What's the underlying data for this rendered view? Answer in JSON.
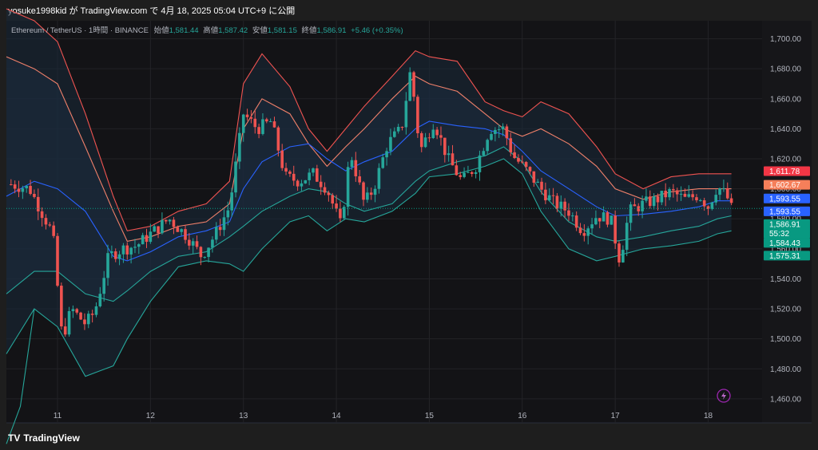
{
  "caption": "yosuke1998kid が TradingView.com で 4月 18, 2025 05:04 UTC+9 に公開",
  "legend": {
    "symbol": "Ethereum / TetherUS · 1時間 · BINANCE",
    "open_label": "始値",
    "open": "1,581.44",
    "high_label": "高値",
    "high": "1,587.42",
    "low_label": "安値",
    "low": "1,581.15",
    "close_label": "終値",
    "close": "1,586.91",
    "change": "+5.46 (+0.35%)"
  },
  "footer": {
    "logo": "TV",
    "wordmark": "TradingView"
  },
  "colors": {
    "up": "#26a69a",
    "down": "#ef5350",
    "basis": "#2962ff",
    "outer_upper": "#ef5350",
    "inner_upper": "#f0806a",
    "inner_lower": "#26a69a",
    "outer_lower": "#26a69a"
  },
  "icons": {
    "bolt": "lightning-icon"
  },
  "chart_data": {
    "type": "candlestick",
    "title": "Ethereum / TetherUS · 1時間 · BINANCE",
    "xlabel": "",
    "ylabel": "",
    "x_ticks": [
      "11",
      "12",
      "13",
      "14",
      "15",
      "16",
      "17",
      "18"
    ],
    "y_ticks": [
      "1,460.00",
      "1,480.00",
      "1,500.00",
      "1,520.00",
      "1,540.00",
      "1,560.00",
      "1,580.00",
      "1,600.00",
      "1,620.00",
      "1,640.00",
      "1,660.00",
      "1,680.00",
      "1,700.00"
    ],
    "y_tick_values": [
      1460,
      1480,
      1500,
      1520,
      1540,
      1560,
      1580,
      1600,
      1620,
      1640,
      1660,
      1680,
      1700
    ],
    "ylim": [
      1444,
      1712
    ],
    "x_range": [
      10.45,
      18.58
    ],
    "grid": true,
    "price_labels": [
      {
        "text": "1,611.78",
        "value": 1611.78,
        "color": "#f23645",
        "sub": ""
      },
      {
        "text": "1,602.67",
        "value": 1602.67,
        "color": "#f57f5a",
        "sub": ""
      },
      {
        "text": "1,593.55",
        "value": 1593.55,
        "color": "#2962ff",
        "sub": ""
      },
      {
        "text": "1,593.55",
        "value": 1585.0,
        "color": "#2962ff",
        "sub": ""
      },
      {
        "text": "1,586.91",
        "value": 1576.5,
        "color": "#089981",
        "sub": "55:32"
      },
      {
        "text": "1,584.43",
        "value": 1564.0,
        "color": "#089981",
        "sub": ""
      },
      {
        "text": "1,575.31",
        "value": 1555.5,
        "color": "#089981",
        "sub": ""
      }
    ],
    "last_price": 1586.91,
    "bands": {
      "x": [
        10.45,
        10.75,
        11.0,
        11.3,
        11.6,
        11.75,
        12.0,
        12.3,
        12.6,
        12.85,
        13.0,
        13.2,
        13.5,
        13.7,
        13.9,
        14.1,
        14.3,
        14.6,
        14.85,
        15.0,
        15.3,
        15.6,
        15.8,
        16.0,
        16.2,
        16.5,
        16.8,
        17.0,
        17.3,
        17.6,
        17.9,
        18.1,
        18.25
      ],
      "outer_upper": [
        1720,
        1712,
        1698,
        1650,
        1595,
        1572,
        1575,
        1585,
        1590,
        1605,
        1670,
        1690,
        1668,
        1640,
        1625,
        1640,
        1655,
        1675,
        1692,
        1688,
        1685,
        1658,
        1652,
        1648,
        1658,
        1650,
        1628,
        1610,
        1600,
        1608,
        1610,
        1610,
        1610
      ],
      "inner_upper": [
        1688,
        1680,
        1670,
        1628,
        1585,
        1565,
        1568,
        1575,
        1578,
        1590,
        1640,
        1660,
        1650,
        1630,
        1615,
        1628,
        1640,
        1660,
        1675,
        1670,
        1665,
        1650,
        1640,
        1635,
        1640,
        1630,
        1615,
        1600,
        1593,
        1598,
        1600,
        1600,
        1600
      ],
      "basis": [
        1595,
        1605,
        1600,
        1585,
        1555,
        1552,
        1558,
        1568,
        1572,
        1578,
        1600,
        1618,
        1628,
        1630,
        1620,
        1612,
        1618,
        1625,
        1640,
        1645,
        1642,
        1640,
        1636,
        1625,
        1612,
        1600,
        1588,
        1582,
        1583,
        1585,
        1588,
        1592,
        1592
      ],
      "inner_lower": [
        1530,
        1545,
        1545,
        1530,
        1525,
        1532,
        1545,
        1555,
        1558,
        1568,
        1575,
        1585,
        1595,
        1600,
        1598,
        1590,
        1585,
        1590,
        1605,
        1612,
        1618,
        1622,
        1628,
        1618,
        1598,
        1578,
        1568,
        1565,
        1568,
        1572,
        1575,
        1580,
        1582
      ],
      "outer_lower": [
        1490,
        1520,
        1508,
        1475,
        1482,
        1500,
        1525,
        1548,
        1552,
        1550,
        1545,
        1560,
        1578,
        1582,
        1572,
        1580,
        1578,
        1585,
        1597,
        1608,
        1610,
        1615,
        1620,
        1610,
        1585,
        1560,
        1552,
        1555,
        1560,
        1562,
        1565,
        1570,
        1572
      ]
    },
    "bands_lead": {
      "outer_lower": [
        [
          10.45,
          1430
        ],
        [
          10.6,
          1455
        ],
        [
          10.75,
          1520
        ]
      ]
    },
    "ohlc_anchors": [
      [
        10.5,
        1603
      ],
      [
        10.7,
        1600
      ],
      [
        10.8,
        1588
      ],
      [
        10.95,
        1570
      ],
      [
        11.05,
        1500
      ],
      [
        11.15,
        1520
      ],
      [
        11.3,
        1510
      ],
      [
        11.4,
        1518
      ],
      [
        11.55,
        1555
      ],
      [
        11.7,
        1560
      ],
      [
        11.85,
        1562
      ],
      [
        12.0,
        1570
      ],
      [
        12.2,
        1580
      ],
      [
        12.4,
        1568
      ],
      [
        12.55,
        1555
      ],
      [
        12.7,
        1570
      ],
      [
        12.85,
        1588
      ],
      [
        13.0,
        1650
      ],
      [
        13.15,
        1640
      ],
      [
        13.3,
        1645
      ],
      [
        13.45,
        1608
      ],
      [
        13.6,
        1605
      ],
      [
        13.75,
        1610
      ],
      [
        13.9,
        1600
      ],
      [
        14.05,
        1575
      ],
      [
        14.15,
        1625
      ],
      [
        14.3,
        1590
      ],
      [
        14.4,
        1600
      ],
      [
        14.55,
        1630
      ],
      [
        14.7,
        1640
      ],
      [
        14.8,
        1680
      ],
      [
        14.9,
        1625
      ],
      [
        15.05,
        1645
      ],
      [
        15.2,
        1620
      ],
      [
        15.35,
        1605
      ],
      [
        15.5,
        1615
      ],
      [
        15.65,
        1640
      ],
      [
        15.8,
        1640
      ],
      [
        15.9,
        1622
      ],
      [
        16.05,
        1612
      ],
      [
        16.2,
        1600
      ],
      [
        16.35,
        1590
      ],
      [
        16.5,
        1585
      ],
      [
        16.65,
        1572
      ],
      [
        16.8,
        1582
      ],
      [
        16.95,
        1580
      ],
      [
        17.05,
        1552
      ],
      [
        17.15,
        1585
      ],
      [
        17.3,
        1590
      ],
      [
        17.45,
        1593
      ],
      [
        17.6,
        1598
      ],
      [
        17.75,
        1593
      ],
      [
        17.9,
        1596
      ],
      [
        18.0,
        1588
      ],
      [
        18.1,
        1602
      ],
      [
        18.2,
        1595
      ],
      [
        18.25,
        1586.9
      ]
    ]
  }
}
